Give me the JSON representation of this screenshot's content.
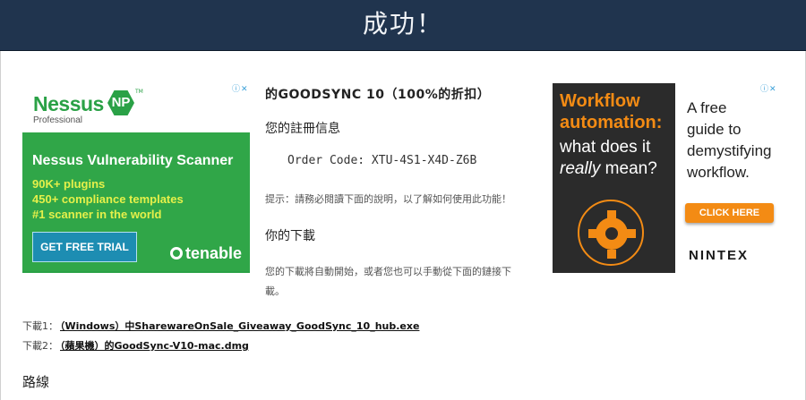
{
  "header": {
    "title": "成功！"
  },
  "ad_left": {
    "adchoice": "ⓘ✕",
    "brand": "Nessus",
    "brand_badge": "NP",
    "brand_tm": "TM",
    "brand_sub": "Professional",
    "headline": "Nessus Vulnerability Scanner",
    "features": [
      "90K+ plugins",
      "450+ compliance templates",
      "#1 scanner in the world"
    ],
    "cta": "GET FREE TRIAL",
    "sponsor": "tenable",
    "colors": {
      "green": "#2aa146",
      "button": "#1d8db2",
      "feature": "#e5f04a"
    }
  },
  "main": {
    "deal_title": "的GOODSYNC 10（100%的折扣）",
    "registration_heading": "您的註冊信息",
    "order_code": "Order Code: XTU-4S1-X4D-Z6B",
    "hint": "提示：請務必閱讀下面的說明，以了解如何使用此功能！",
    "download_heading": "你的下載",
    "download_description": "您的下載將自動開始，或者您也可以手動從下面的鏈接下載。"
  },
  "ad_right": {
    "adchoice": "ⓘ✕",
    "headline_1": "Workflow",
    "headline_2": "automation:",
    "question_1": "what does it",
    "question_2a": "really",
    "question_2b": " mean?",
    "guide_1": "A free",
    "guide_2": "guide to",
    "guide_3": "demystifying",
    "guide_4": "workflow.",
    "cta": "CLICK HERE",
    "brand": "NINTEX",
    "colors": {
      "orange": "#f38b14",
      "dark": "#2b2b2b"
    }
  },
  "downloads": [
    {
      "label": "下載1：",
      "link": "（Windows）中SharewareOnSale_Giveaway_GoodSync_10_hub.exe"
    },
    {
      "label": "下載2：",
      "link": "（蘋果機）的GoodSync-V10-mac.dmg"
    }
  ],
  "route_heading": "路線"
}
